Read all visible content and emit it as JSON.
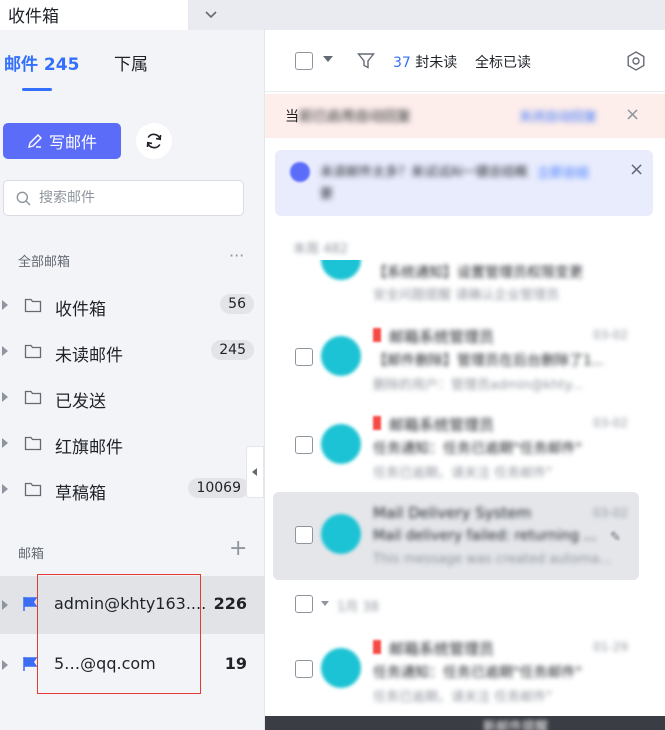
{
  "window_tab": {
    "title": "收件箱"
  },
  "sidebar": {
    "tab_mail": "邮件 245",
    "tab_subordinate": "下属",
    "compose_label": "写邮件",
    "search_placeholder": "搜索邮件",
    "all_mailboxes_title": "全部邮箱",
    "more_icon": "···",
    "folders": [
      {
        "name": "收件箱",
        "count": "56"
      },
      {
        "name": "未读邮件",
        "count": "245"
      },
      {
        "name": "已发送",
        "count": ""
      },
      {
        "name": "红旗邮件",
        "count": ""
      },
      {
        "name": "草稿箱",
        "count": "10069"
      }
    ],
    "accounts_title": "邮箱",
    "add_icon": "+",
    "accounts": [
      {
        "address": "admin@khty163....",
        "count": "226"
      },
      {
        "address": "5…@qq.com",
        "count": "19"
      }
    ]
  },
  "toolbar": {
    "unread_count": "37",
    "unread_label": "封未读",
    "mark_all_read": "全标已读"
  },
  "notice_bar": {
    "prefix": "当",
    "blurred": "前已启用自动回复",
    "link": "关闭自动回复",
    "close": "×"
  },
  "ai_banner": {
    "text": "未读邮件太多？来试试AI一键总结概要",
    "link": "立即总结",
    "close": "×"
  },
  "groups": {
    "today": "本周 482",
    "earlier": "1月 38"
  },
  "mails": [
    {
      "sender": "邮箱系统管理员",
      "date": "03-02",
      "subject": "【邮件删除】管理员在后台删除了1...",
      "preview": "删除的用户：管理员admin@khty..."
    },
    {
      "sender": "邮箱系统管理员",
      "date": "03-02",
      "subject": "任务通知：任务已逾期\"任务邮件\"",
      "preview": "任务已逾期，请关注 任务邮件\""
    },
    {
      "sender": "Mail Delivery System",
      "date": "03-02",
      "subject": "Mail delivery failed: returning ...",
      "preview": "This message was created automa..."
    },
    {
      "sender": "邮箱系统管理员",
      "date": "01-29",
      "subject": "任务通知：任务已逾期\"任务邮件\"",
      "preview": "任务已逾期，请关注 任务邮件\""
    }
  ],
  "partial_mail": {
    "subject": "【系统通知】设置管理员权限变更",
    "preview": "安全问题提醒 请确认企业管理员"
  },
  "bottom_text": "新邮件提醒",
  "colors": {
    "accent": "#3370ff",
    "compose": "#5b6cf9",
    "avatar": "#1cc3d4",
    "flag": "#3a6cf4"
  }
}
